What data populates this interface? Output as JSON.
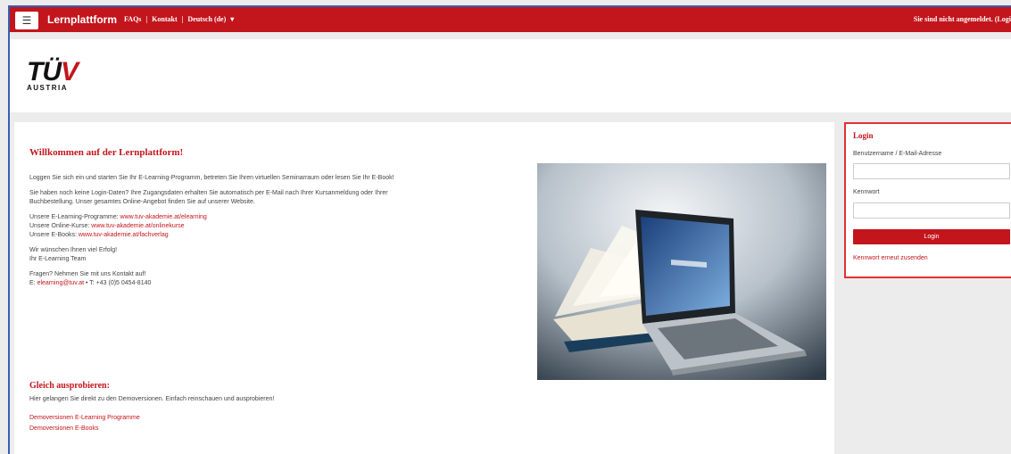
{
  "header": {
    "menu_icon": "hamburger-icon",
    "brand": "Lernplattform",
    "links": [
      "FAQs",
      "|",
      "Kontakt",
      "|",
      "Deutsch (de)",
      "▾"
    ],
    "login_status": "Sie sind nicht angemeldet. (Logi"
  },
  "logo": {
    "text_main": "TÜ",
    "text_v": "V",
    "text_sub": "AUSTRIA"
  },
  "welcome": {
    "title": "Willkommen auf der Lernplattform!",
    "p1": "Loggen Sie sich ein und starten Sie Ihr E-Learning-Programm, betreten Sie Ihren virtuellen Seminarraum oder lesen Sie Ihr E-Book!",
    "p2": "Sie haben noch keine Login-Daten? Ihre Zugangsdaten erhalten Sie automatisch per E-Mail nach Ihrer Kursanmeldung oder Ihrer Buchbestellung. Unser gesamtes Online-Angebot finden Sie auf unserer Website.",
    "programs_label": "Unsere E-Learning-Programme: ",
    "programs_link": "www.tuv-akademie.at/elearning",
    "courses_label": "Unsere Online-Kurse: ",
    "courses_link": "www.tuv-akademie.at/onlinekurse",
    "books_label": "Unsere E-Books: ",
    "books_link": "www.tuv-akademie.at/fachverlag",
    "wish1": "Wir wünschen Ihnen viel Erfolg!",
    "wish2": "Ihr E-Learning Team",
    "questions": "Fragen? Nehmen Sie mit uns Kontakt auf!",
    "email_prefix": "E: ",
    "email": "elearning@tuv.at",
    "phone": " • T: +43 (0)5 0454-8140"
  },
  "demo": {
    "title": "Gleich ausprobieren:",
    "text": "Hier gelangen Sie direkt zu den Demoversionen. Einfach reinschauen und ausprobieren!",
    "link1": "Demoversionen E-Learning Programme",
    "link2": "Demoversionen E-Books"
  },
  "login": {
    "title": "Login",
    "username_label": "Benutzername / E-Mail-Adresse",
    "username_value": "",
    "password_label": "Kennwort",
    "password_value": "",
    "button": "Login",
    "forgot": "Kennwort erneut zusenden"
  },
  "colors": {
    "brand_red": "#c3151c",
    "frame_blue": "#3a5fb0"
  }
}
